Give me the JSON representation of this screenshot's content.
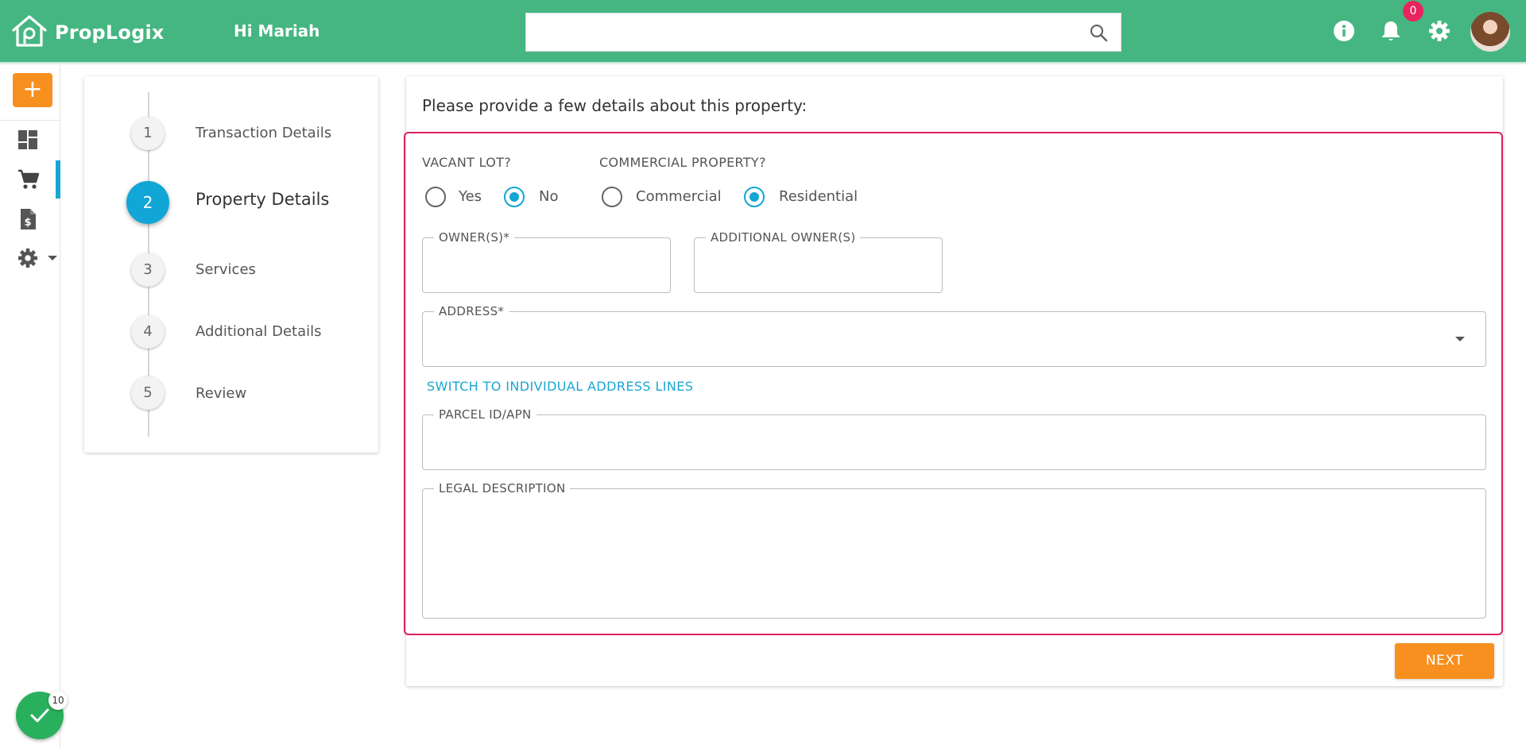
{
  "header": {
    "logo_text": "PropLogix",
    "greeting": "Hi Mariah",
    "search": {
      "value": "",
      "placeholder": ""
    },
    "notification_count": "0",
    "icons": [
      "info-icon",
      "bell-icon",
      "gear-icon",
      "avatar"
    ]
  },
  "rail": {
    "add_label": "+",
    "items": [
      {
        "name": "dashboard",
        "icon": "dashboard-icon",
        "active": false
      },
      {
        "name": "orders",
        "icon": "cart-icon",
        "active": true
      },
      {
        "name": "invoices",
        "icon": "invoice-icon",
        "active": false
      },
      {
        "name": "settings",
        "icon": "gear-icon",
        "active": false
      }
    ],
    "status_count": "10"
  },
  "stepper": {
    "steps": [
      {
        "number": "1",
        "label": "Transaction Details",
        "active": false
      },
      {
        "number": "2",
        "label": "Property Details",
        "active": true
      },
      {
        "number": "3",
        "label": "Services",
        "active": false
      },
      {
        "number": "4",
        "label": "Additional Details",
        "active": false
      },
      {
        "number": "5",
        "label": "Review",
        "active": false
      }
    ]
  },
  "form": {
    "title": "Please provide a few details about this property:",
    "vacant_lot": {
      "label": "VACANT LOT?",
      "options": [
        "Yes",
        "No"
      ],
      "selected": "No"
    },
    "commercial_property": {
      "label": "COMMERCIAL PROPERTY?",
      "options": [
        "Commercial",
        "Residential"
      ],
      "selected": "Residential"
    },
    "owners": {
      "label": "OWNER(S)*",
      "value": ""
    },
    "additional_owners": {
      "label": "ADDITIONAL OWNER(S)",
      "value": ""
    },
    "address": {
      "label": "ADDRESS*",
      "value": ""
    },
    "switch_link": "SWITCH TO INDIVIDUAL ADDRESS LINES",
    "parcel_id": {
      "label": "PARCEL ID/APN",
      "value": ""
    },
    "legal_description": {
      "label": "LEGAL DESCRIPTION",
      "value": ""
    },
    "next_label": "NEXT"
  },
  "colors": {
    "header_green": "#45b681",
    "accent_blue": "#12a6d6",
    "orange": "#f7901e",
    "highlight_red": "#dc1f5d",
    "status_green": "#29b05c"
  }
}
